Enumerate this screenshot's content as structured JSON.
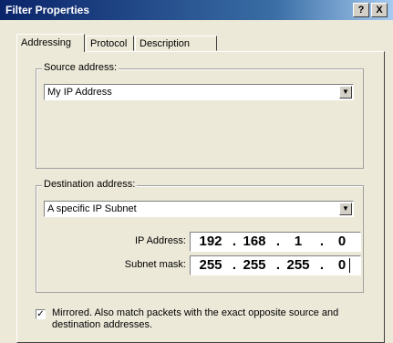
{
  "window": {
    "title": "Filter Properties",
    "help_glyph": "?",
    "close_glyph": "X"
  },
  "tabs": [
    {
      "label": "Addressing",
      "active": true
    },
    {
      "label": "Protocol",
      "active": false
    },
    {
      "label": "Description",
      "active": false
    }
  ],
  "source": {
    "group_label": "Source address:",
    "selected": "My IP Address"
  },
  "destination": {
    "group_label": "Destination address:",
    "selected": "A specific IP Subnet",
    "ip_label": "IP Address:",
    "ip": [
      "192",
      "168",
      "1",
      "0"
    ],
    "mask_label": "Subnet mask:",
    "mask": [
      "255",
      "255",
      "255",
      "0"
    ]
  },
  "mirrored": {
    "checked": true,
    "label": "Mirrored. Also match packets with the exact opposite source and destination addresses."
  },
  "separators": {
    "dot": "."
  },
  "glyphs": {
    "dropdown_arrow": "▼",
    "checkmark": "✓"
  },
  "colors": {
    "titlebar_start": "#0a246a",
    "titlebar_end": "#a6caf0",
    "dialog_bg": "#ece9d8"
  }
}
